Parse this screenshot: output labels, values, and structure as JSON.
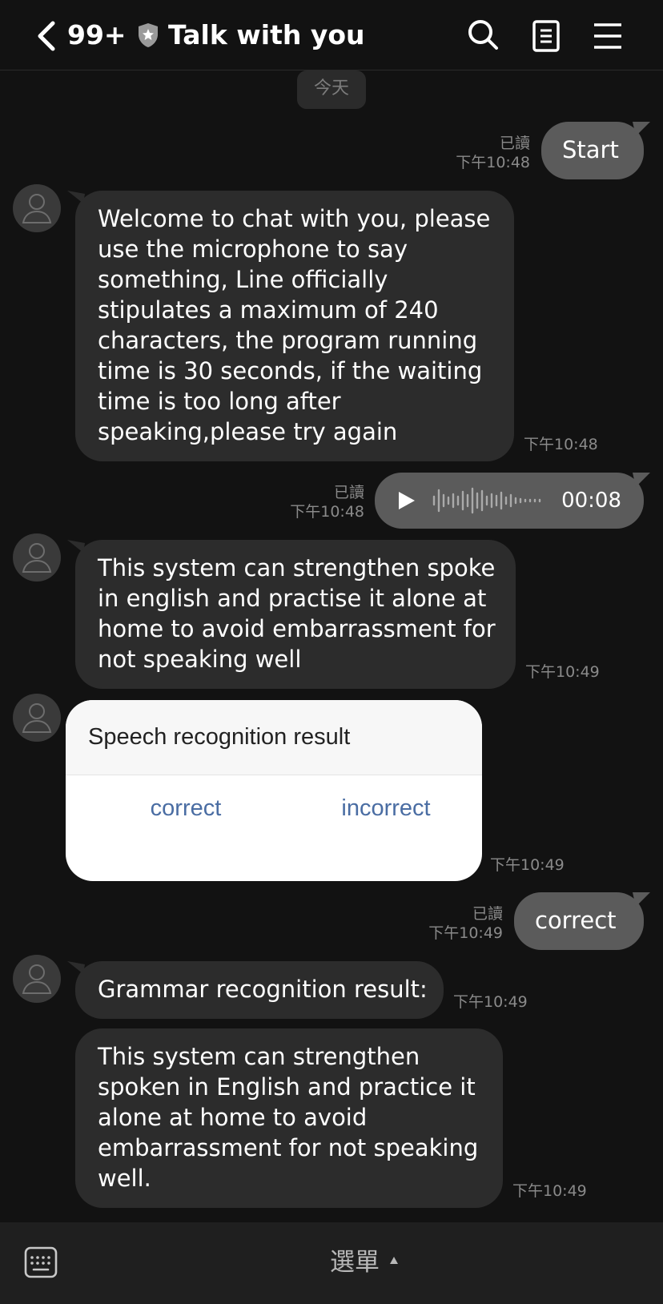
{
  "header": {
    "unread_count": "99+",
    "title": "Talk with you"
  },
  "date_chip": "今天",
  "messages": [
    {
      "id": "m1",
      "side": "out",
      "text": "Start",
      "read_label": "已讀",
      "time": "下午10:48"
    },
    {
      "id": "m2",
      "side": "in",
      "lines": [
        "Welcome to chat with you, please",
        "use the microphone to say",
        "something, Line officially",
        "stipulates a maximum of 240",
        "characters, the program running",
        "time is 30 seconds, if the waiting",
        "time is too long after",
        "speaking,please try again"
      ],
      "time": "下午10:48"
    },
    {
      "id": "m3",
      "side": "out",
      "type": "voice",
      "duration": "00:08",
      "read_label": "已讀",
      "time": "下午10:48"
    },
    {
      "id": "m4",
      "side": "in",
      "lines": [
        "This system can strengthen spoke",
        "in english and practise it alone at",
        "home to avoid embarrassment for",
        "not speaking well"
      ],
      "time": "下午10:49"
    },
    {
      "id": "m5",
      "side": "in",
      "type": "card",
      "card_title": "Speech recognition result",
      "actions": [
        "correct",
        "incorrect"
      ],
      "time": "下午10:49"
    },
    {
      "id": "m6",
      "side": "out",
      "text": "correct",
      "read_label": "已讀",
      "time": "下午10:49"
    },
    {
      "id": "m7",
      "side": "in",
      "text": "Grammar recognition result:",
      "time": "下午10:49"
    },
    {
      "id": "m8",
      "side": "in",
      "lines": [
        "This system can strengthen",
        "spoken in English and practice it",
        "alone at home to avoid",
        "embarrassment for not speaking",
        "well."
      ],
      "time": "下午10:49"
    }
  ],
  "bottom_bar": {
    "menu_label": "選單"
  },
  "colors": {
    "background": "#121212",
    "incoming_bubble": "#2c2c2c",
    "outgoing_bubble": "#5b5b5b",
    "card_link": "#4a6da3"
  }
}
